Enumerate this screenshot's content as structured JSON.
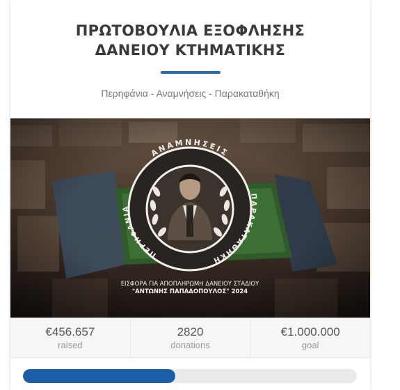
{
  "campaign": {
    "title_line1": "ΠΡΩΤΟΒΟΥΛΙΑ ΕΞΟΦΛΗΣΗΣ",
    "title_line2": "ΔΑΝΕΙΟΥ ΚΤΗΜΑΤΙΚΗΣ",
    "tagline": "Περηφάνια - Αναμνήσεις - Παρακαταθήκη",
    "accent_color": "#2a6bb0"
  },
  "banner": {
    "emblem_top": "ΑΝΑΜΝΗΣΕΙΣ",
    "emblem_left": "ΠΕΡΗΦΑΝΙΑ",
    "emblem_right": "ΠΑΡΑΚΑΤΑΘΗΚΗ",
    "caption_line1": "ΕΙΣΦΟΡΑ ΓΙΑ ΑΠΟΠΛΗΡΩΜΗ ΔΑΝΕΙΟΥ ΣΤΑΔΙΟΥ",
    "caption_line2": "\"ΑΝΤΩΝΗΣ ΠΑΠΑΔΟΠΟΥΛΟΣ\" 2024"
  },
  "stats": {
    "raised_value": "€456.657",
    "raised_label": "raised",
    "donations_value": "2820",
    "donations_label": "donations",
    "goal_value": "€1.000.000",
    "goal_label": "goal"
  },
  "progress": {
    "fraction": 0.4567,
    "fill_color": "#1d5ea8"
  }
}
